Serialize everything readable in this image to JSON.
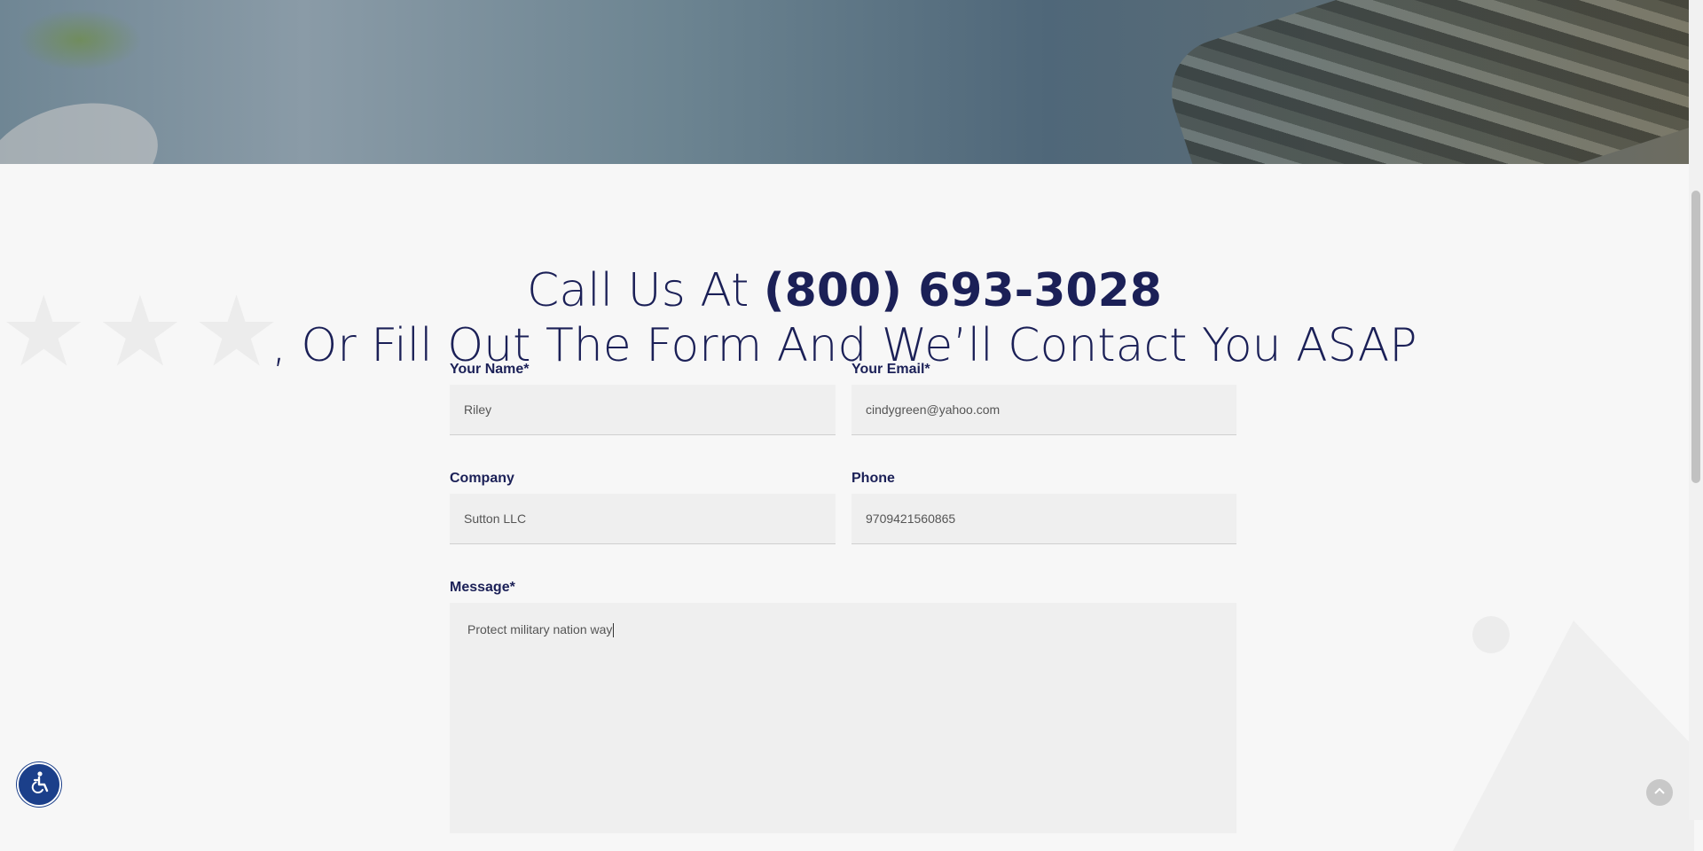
{
  "heading": {
    "prefix": "Call Us At ",
    "phone": "(800) 693-3028",
    "suffix": ", Or Fill Out The Form And We’ll Contact You ASAP"
  },
  "form": {
    "name": {
      "label": "Your Name",
      "required_mark": "*",
      "value": "Riley"
    },
    "email": {
      "label": "Your Email",
      "required_mark": "*",
      "value": "cindygreen@yahoo.com"
    },
    "company": {
      "label": "Company",
      "value": "Sutton LLC"
    },
    "phone": {
      "label": "Phone",
      "value": "9709421560865"
    },
    "message": {
      "label": "Message",
      "required_mark": "*",
      "value": "Protect military nation way"
    }
  },
  "icons": {
    "accessibility": "accessibility-icon",
    "scroll_top": "chevron-up-icon"
  },
  "colors": {
    "brand_navy": "#1b2057",
    "accessibility_blue": "#1b3f8a"
  }
}
